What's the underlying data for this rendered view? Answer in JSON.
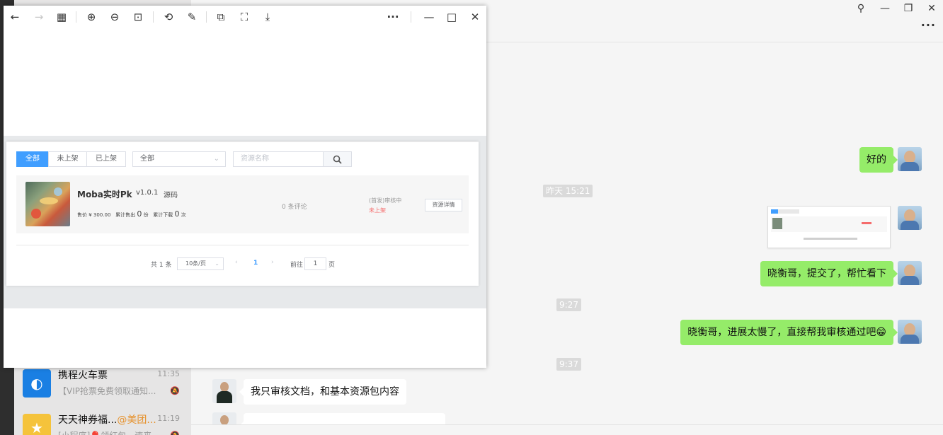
{
  "chat": {
    "contacts": [
      {
        "name": "携程火车票",
        "name_highlight": "",
        "time": "11:35",
        "preview": "【VIP抢票免费领取通知...",
        "mute": "🔕",
        "avatar_color": "#1a7fe3",
        "avatar_icon": "dolphin-icon"
      },
      {
        "name": "天天神券福...",
        "name_highlight": "@美团...",
        "time": "11:19",
        "preview": "[小程序]🎈领红包，速来...",
        "mute": "🔕",
        "avatar_color": "#f5c33b",
        "avatar_icon": "mascot-icon"
      }
    ],
    "header": {
      "pin": "⚲",
      "minimize": "—",
      "restore": "❐",
      "close": "✕",
      "more": "···"
    },
    "messages": [
      {
        "text": "好的"
      },
      {
        "time": "昨天 15:21"
      },
      {
        "text": "晓衡哥，提交了，帮忙看下"
      },
      {
        "time": "9:27"
      },
      {
        "text": "晓衡哥，进展太慢了，直接帮我审核通过吧😁"
      },
      {
        "time": "9:37"
      },
      {
        "text": "我只审核文档，和基本资源包内容"
      }
    ]
  },
  "viewer": {
    "toolbar": {
      "back": "←",
      "forward": "→",
      "grid": "▦",
      "zoom_in": "⊕",
      "zoom_out": "⊖",
      "fit": "⊡",
      "rotate": "⟲",
      "edit": "✎",
      "copy": "⧉",
      "scan": "⛶",
      "download": "⤓",
      "more": "···",
      "minimize": "—",
      "maximize": "□",
      "close": "✕"
    },
    "filter_tabs": [
      "全部",
      "未上架",
      "已上架"
    ],
    "filter_select": "全部",
    "search_placeholder": "资源名称",
    "resource": {
      "title": "Moba实时Pk",
      "version": "v1.0.1",
      "type": "源码",
      "price_label": "售价 ¥ 300.00",
      "sold_label": "累计售出",
      "sold_value": "0",
      "sold_unit": "份",
      "download_label": "累计下载",
      "download_value": "0",
      "download_unit": "次",
      "comments": "0 条评论",
      "review": "(首发)审核中",
      "status": "未上架",
      "detail_button": "资源详情"
    },
    "pager": {
      "total": "共 1 条",
      "page_size": "10条/页",
      "prev": "‹",
      "current": "1",
      "next": "›",
      "goto_label": "前往",
      "goto_value": "1",
      "goto_unit": "页"
    }
  }
}
